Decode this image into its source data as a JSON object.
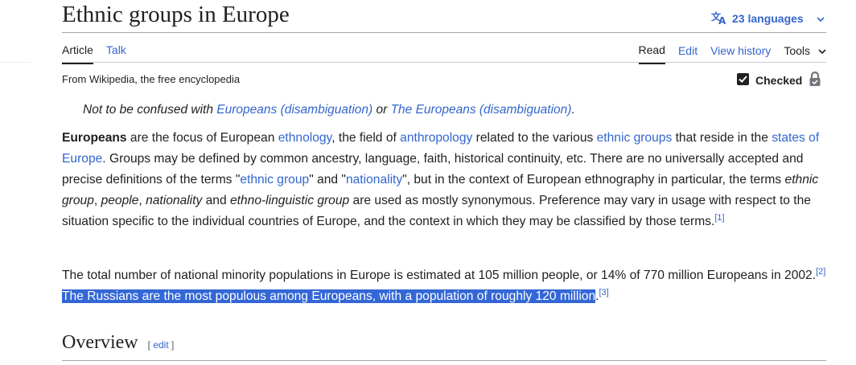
{
  "page": {
    "title": "Ethnic groups in Europe",
    "languages_label": "23 languages"
  },
  "tabs": {
    "article": "Article",
    "talk": "Talk",
    "read": "Read",
    "edit": "Edit",
    "view_history": "View history",
    "tools": "Tools"
  },
  "tagline": "From Wikipedia, the free encyclopedia",
  "status": {
    "checked_label": "Checked"
  },
  "hatnote": {
    "prefix": "Not to be confused with ",
    "link1": "Europeans (disambiguation)",
    "mid": " or ",
    "link2": "The Europeans (disambiguation)",
    "suffix": "."
  },
  "paragraph1": {
    "bold": "Europeans",
    "t1": " are the focus of European ",
    "l1": "ethnology",
    "t2": ", the field of ",
    "l2": "anthropology",
    "t3": " related to the various ",
    "l3": "ethnic groups",
    "t4": " that reside in the ",
    "l4": "states of Europe",
    "t5": ". Groups may be defined by common ancestry, language, faith, historical continuity, etc. There are no universally accepted and precise definitions of the terms \"",
    "l5": "ethnic group",
    "t6": "\" and \"",
    "l6": "nationality",
    "t7": "\", but in the context of European ethnography in particular, the terms ",
    "i1": "ethnic group",
    "t8": ", ",
    "i2": "people",
    "t9": ", ",
    "i3": "nationality",
    "t10": " and ",
    "i4": "ethno-linguistic group",
    "t11": " are used as mostly synonymous. Preference may vary in usage with respect to the situation specific to the individual countries of Europe, and the context in which they may be classified by those terms.",
    "ref": "[1]"
  },
  "paragraph2": {
    "t1": "The total number of national minority populations in Europe is estimated at 105 million people, or 14% of 770 million Europeans in 2002.",
    "ref2": "[2]",
    "selected": " The Russians are the most populous among Europeans, with a population of roughly 120 million",
    "t2": ".",
    "ref3": "[3]"
  },
  "section": {
    "heading": "Overview",
    "edit_open": "[ ",
    "edit_label": "edit",
    "edit_close": " ]"
  },
  "icons": {
    "language": "translate-icon",
    "chevron": "chevron-down-icon",
    "checkbox": "checkbox-checked-icon",
    "lock": "lock-icon"
  },
  "colors": {
    "link": "#3366cc",
    "selection": "#3367d6",
    "text": "#202122"
  }
}
